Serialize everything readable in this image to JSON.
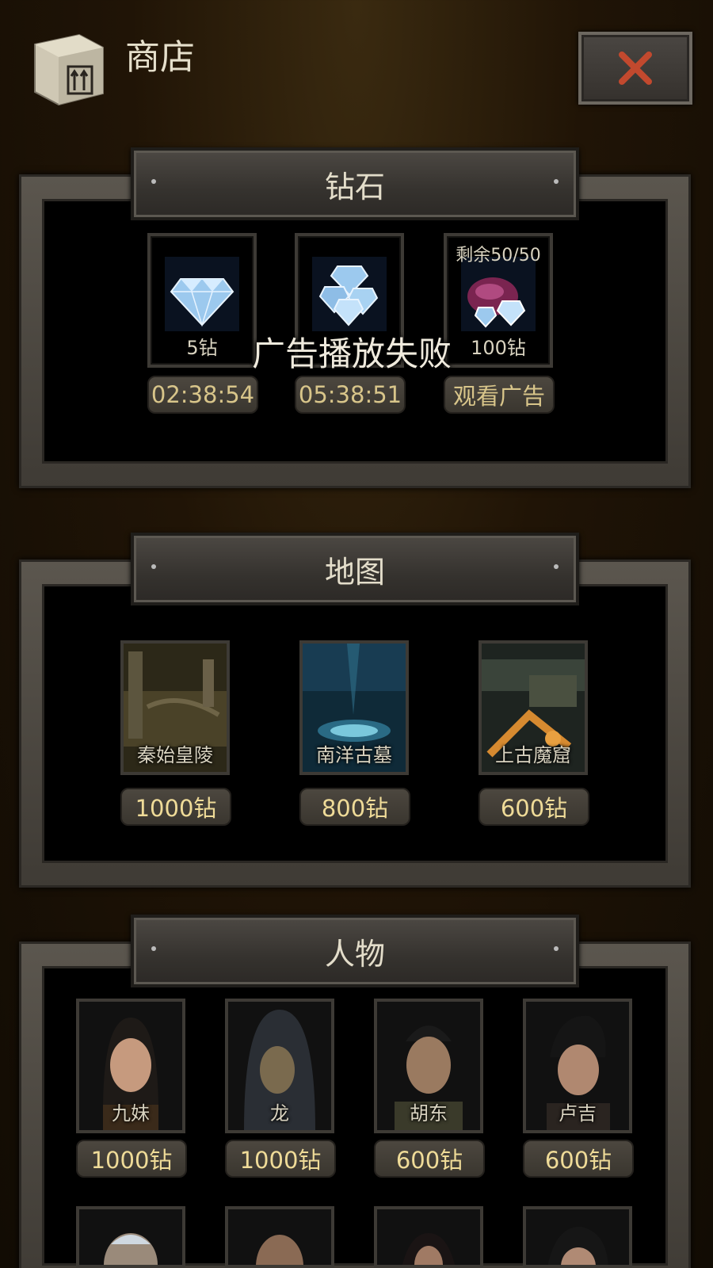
{
  "header": {
    "title": "商店",
    "icon": "box-icon",
    "close_icon": "close-icon"
  },
  "colors": {
    "accent_price": "#efdb98",
    "close_x": "#c2492e",
    "panel_frame": "#5b564e"
  },
  "diamond_section": {
    "title": "钻石",
    "items": [
      {
        "name": "diamond-small",
        "amount_label": "5钻",
        "top_label": "",
        "action": "02:38:54"
      },
      {
        "name": "diamond-pile",
        "amount_label": "",
        "top_label": "",
        "action": "05:38:51"
      },
      {
        "name": "diamond-bag",
        "amount_label": "100钻",
        "top_label": "剩余50/50",
        "action": "观看广告"
      }
    ]
  },
  "toast": {
    "message": "广告播放失败"
  },
  "map_section": {
    "title": "地图",
    "items": [
      {
        "name": "秦始皇陵",
        "price": "1000钻"
      },
      {
        "name": "南洋古墓",
        "price": "800钻"
      },
      {
        "name": "上古魔窟",
        "price": "600钻"
      }
    ]
  },
  "character_section": {
    "title": "人物",
    "items": [
      {
        "name": "九妹",
        "price": "1000钻"
      },
      {
        "name": "龙",
        "price": "1000钻"
      },
      {
        "name": "胡东",
        "price": "600钻"
      },
      {
        "name": "卢吉",
        "price": "600钻"
      }
    ]
  }
}
